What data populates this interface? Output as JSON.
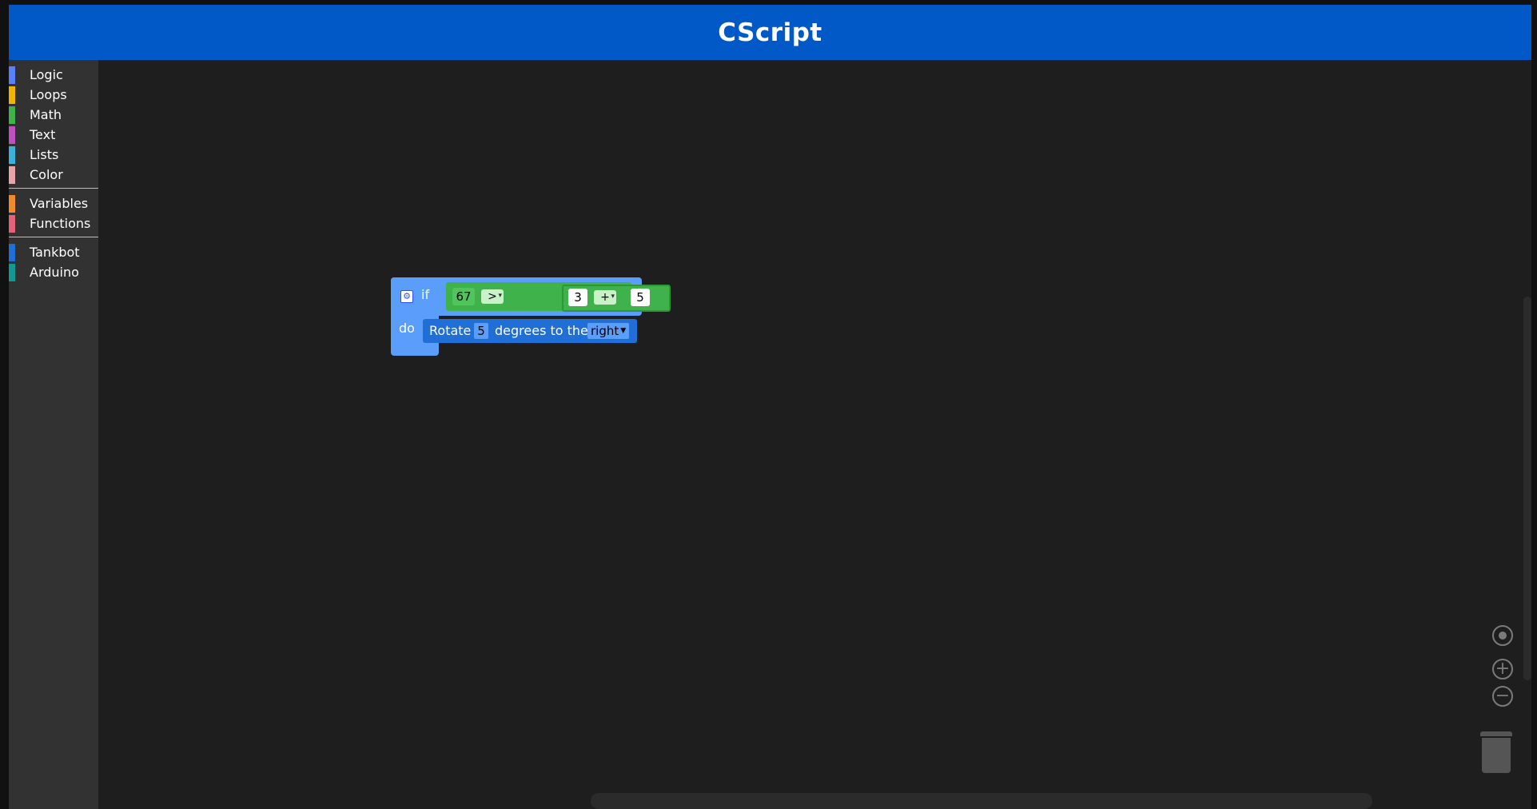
{
  "header": {
    "title": "CScript"
  },
  "toolbox": {
    "groups": [
      [
        {
          "label": "Logic",
          "color": "#5b80ff"
        },
        {
          "label": "Loops",
          "color": "#f2b400"
        },
        {
          "label": "Math",
          "color": "#3fb24b"
        },
        {
          "label": "Text",
          "color": "#c04fbf"
        },
        {
          "label": "Lists",
          "color": "#3bb3d9"
        },
        {
          "label": "Color",
          "color": "#e9a4a8"
        }
      ],
      [
        {
          "label": "Variables",
          "color": "#ef8a2d"
        },
        {
          "label": "Functions",
          "color": "#e5627c"
        }
      ],
      [
        {
          "label": "Tankbot",
          "color": "#1f6fd6"
        },
        {
          "label": "Arduino",
          "color": "#119a91"
        }
      ]
    ]
  },
  "blocks": {
    "if_block": {
      "if_label": "if",
      "do_label": "do",
      "compare": {
        "left": "67",
        "op": ">"
      },
      "arith": {
        "left": "3",
        "op": "+",
        "right": "5"
      },
      "rotate": {
        "prefix": "Rotate",
        "value": "5",
        "middle": "degrees to the",
        "direction": "right"
      }
    }
  }
}
